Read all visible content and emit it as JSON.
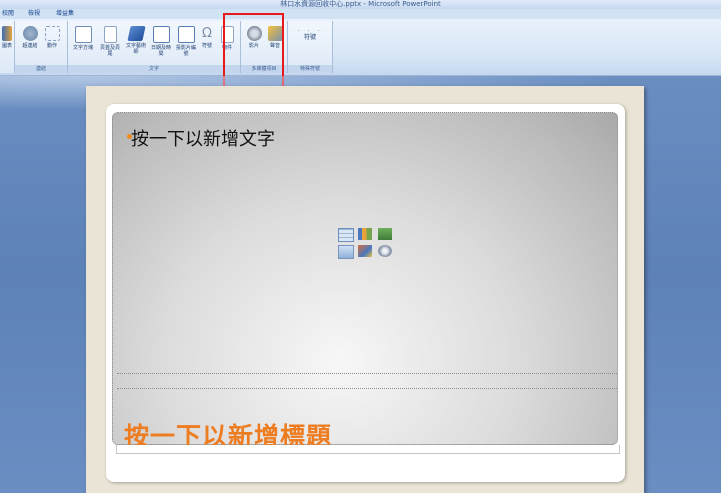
{
  "window": {
    "title": "林口水資源回收中心.pptx - Microsoft PowerPoint"
  },
  "tabs": [
    "校閱",
    "檢視",
    "增益集"
  ],
  "ribbon": {
    "groups": [
      {
        "label": "連結",
        "buttons": [
          "超連結",
          "動作"
        ]
      },
      {
        "label": "文字",
        "buttons": [
          "文字方塊",
          "頁首及頁尾",
          "文字藝術師",
          "日期及時間",
          "投影片編號",
          "符號",
          "物件"
        ]
      },
      {
        "label": "多媒體項目",
        "buttons": [
          "影片",
          "聲音"
        ]
      },
      {
        "label": "特殊符號",
        "buttons": [
          "符號"
        ]
      }
    ],
    "left_fragment": "圖表",
    "highlight_color": "#e8191c"
  },
  "slide": {
    "bullet_placeholder": "按一下以新增文字",
    "title_placeholder": "按一下以新增標題",
    "accent_color": "#ee7d22",
    "content_icons": [
      "table-icon",
      "chart-icon",
      "smartart-icon",
      "picture-icon",
      "clipart-icon",
      "media-icon"
    ]
  }
}
